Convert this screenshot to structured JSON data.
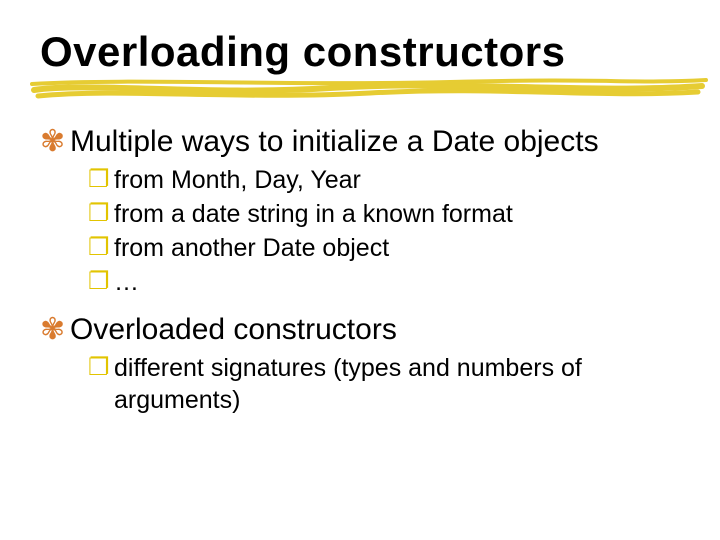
{
  "title": "Overloading constructors",
  "sections": [
    {
      "heading": "Multiple ways to initialize a Date objects",
      "items": [
        "from Month, Day, Year",
        "from a date string in a known format",
        "from another Date object",
        "…"
      ]
    },
    {
      "heading": "Overloaded constructors",
      "items": [
        "different signatures (types and numbers of arguments)"
      ]
    }
  ],
  "bullets": {
    "level1": "✾",
    "level2": "❐"
  }
}
